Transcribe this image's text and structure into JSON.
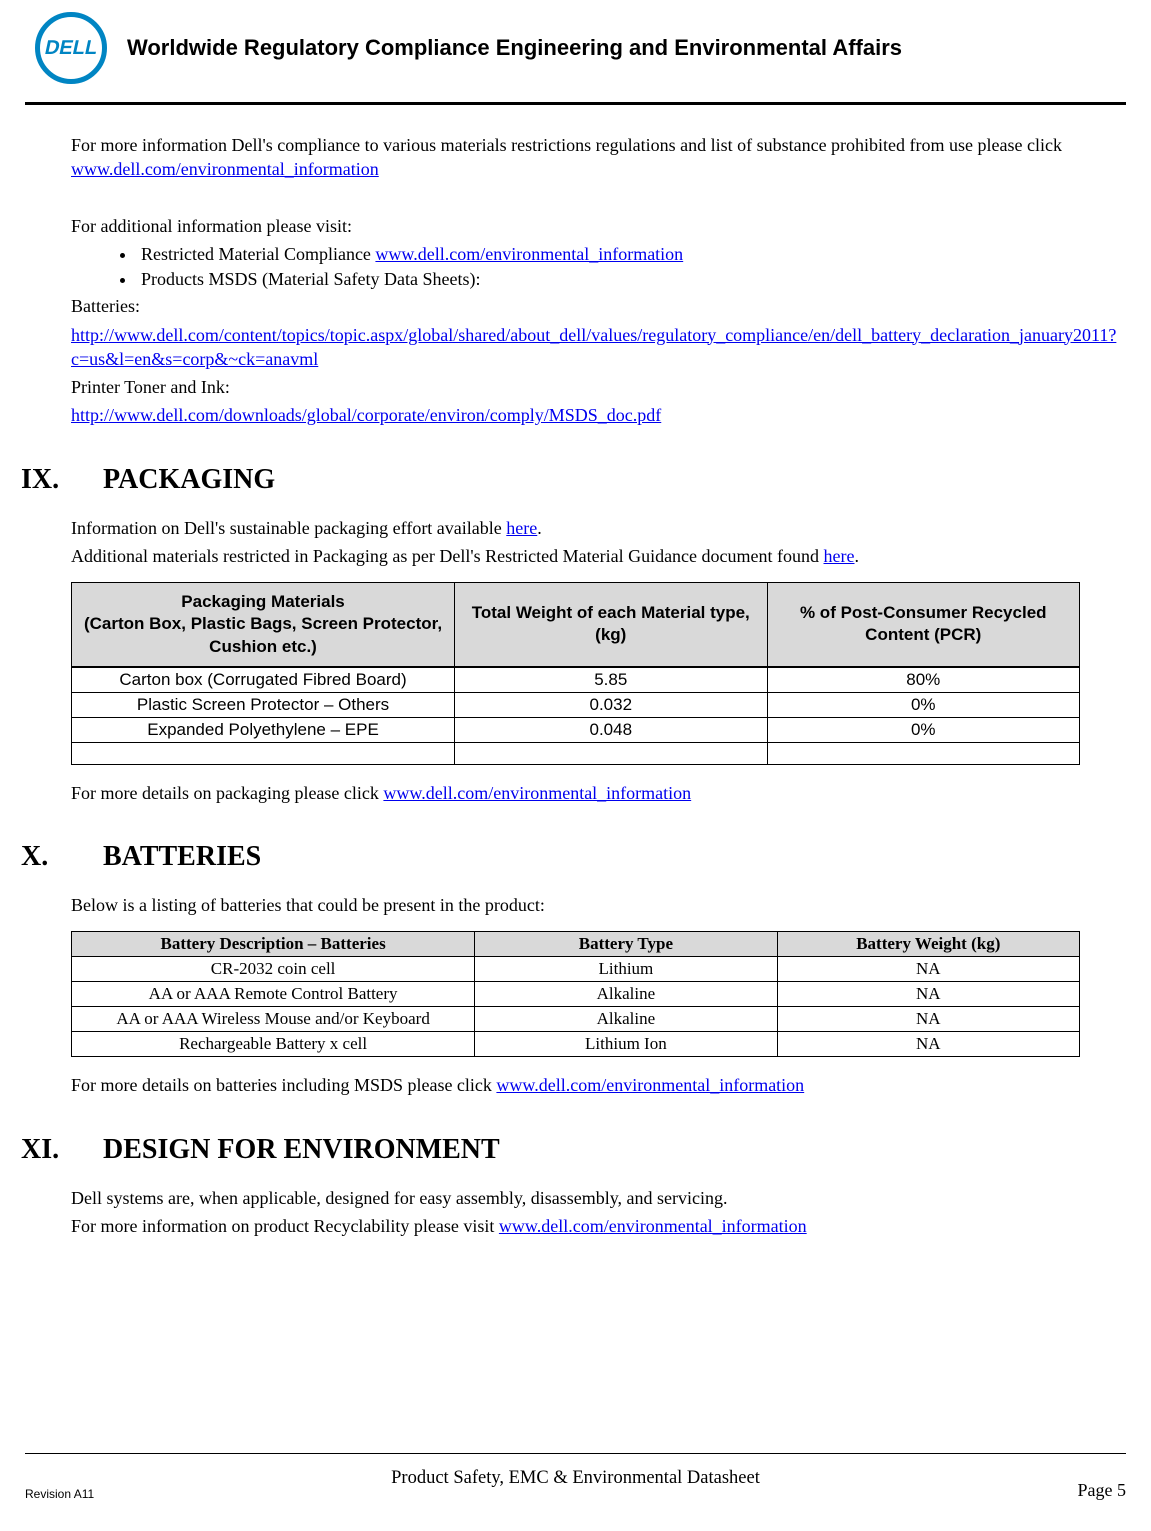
{
  "header": {
    "logo_text": "DELL",
    "title": "Worldwide Regulatory Compliance Engineering and Environmental Affairs"
  },
  "intro": {
    "p1_pre": "For more information Dell's compliance to various materials restrictions regulations and list of substance prohibited from use please click ",
    "p1_link": "www.dell.com/environmental_information",
    "p2": "For additional information please visit:",
    "bullet1_pre": "Restricted Material Compliance ",
    "bullet1_link": "www.dell.com/environmental_information",
    "bullet2": "Products MSDS (Material Safety Data Sheets):",
    "batteries_label": "Batteries:",
    "batteries_link": "http://www.dell.com/content/topics/topic.aspx/global/shared/about_dell/values/regulatory_compliance/en/dell_battery_declaration_january2011?c=us&l=en&s=corp&~ck=anavml",
    "printer_label": "Printer Toner and Ink:",
    "printer_link": "http://www.dell.com/downloads/global/corporate/environ/comply/MSDS_doc.pdf"
  },
  "sec9": {
    "num": "IX.",
    "title": "PACKAGING",
    "p1_pre": "Information on Dell's sustainable packaging effort available ",
    "p1_link": "here",
    "p1_post": ".",
    "p2_pre": "Additional materials restricted in Packaging as per Dell's Restricted Material Guidance document found ",
    "p2_link": "here",
    "p2_post": ".",
    "table": {
      "h1a": "Packaging Materials",
      "h1b": "(Carton Box, Plastic Bags, Screen Protector, Cushion etc.)",
      "h2": "Total Weight of each Material type, (kg)",
      "h3": "% of Post-Consumer Recycled Content (PCR)",
      "rows": [
        {
          "c1": "Carton box (Corrugated Fibred Board)",
          "c2": "5.85",
          "c3": "80%"
        },
        {
          "c1": "Plastic Screen Protector – Others",
          "c2": "0.032",
          "c3": "0%"
        },
        {
          "c1": "Expanded Polyethylene – EPE",
          "c2": "0.048",
          "c3": "0%"
        }
      ]
    },
    "p3_pre": "For more details on packaging please click ",
    "p3_link": "www.dell.com/environmental_information"
  },
  "sec10": {
    "num": "X.",
    "title": "BATTERIES",
    "p1": "Below is a listing of batteries that could be present in the product:",
    "table": {
      "h1": "Battery Description – Batteries",
      "h2": "Battery Type",
      "h3": "Battery Weight (kg)",
      "rows": [
        {
          "c1": "CR-2032 coin cell",
          "c2": "Lithium",
          "c3": "NA"
        },
        {
          "c1": "AA or AAA Remote Control Battery",
          "c2": "Alkaline",
          "c3": "NA"
        },
        {
          "c1": "AA or AAA Wireless Mouse and/or Keyboard",
          "c2": "Alkaline",
          "c3": "NA"
        },
        {
          "c1": "Rechargeable Battery x cell",
          "c2": "Lithium Ion",
          "c3": "NA"
        }
      ]
    },
    "p2_pre": "For more details on batteries including MSDS please click ",
    "p2_link": "www.dell.com/environmental_information"
  },
  "sec11": {
    "num": "XI.",
    "title": "DESIGN FOR ENVIRONMENT",
    "p1": "Dell systems are, when applicable, designed for easy assembly, disassembly, and servicing.",
    "p2_pre": "For more information on product Recyclability please visit ",
    "p2_link": "www.dell.com/environmental_information"
  },
  "footer": {
    "revision": "Revision A11",
    "center": "Product Safety, EMC & Environmental Datasheet",
    "page": "Page 5"
  }
}
